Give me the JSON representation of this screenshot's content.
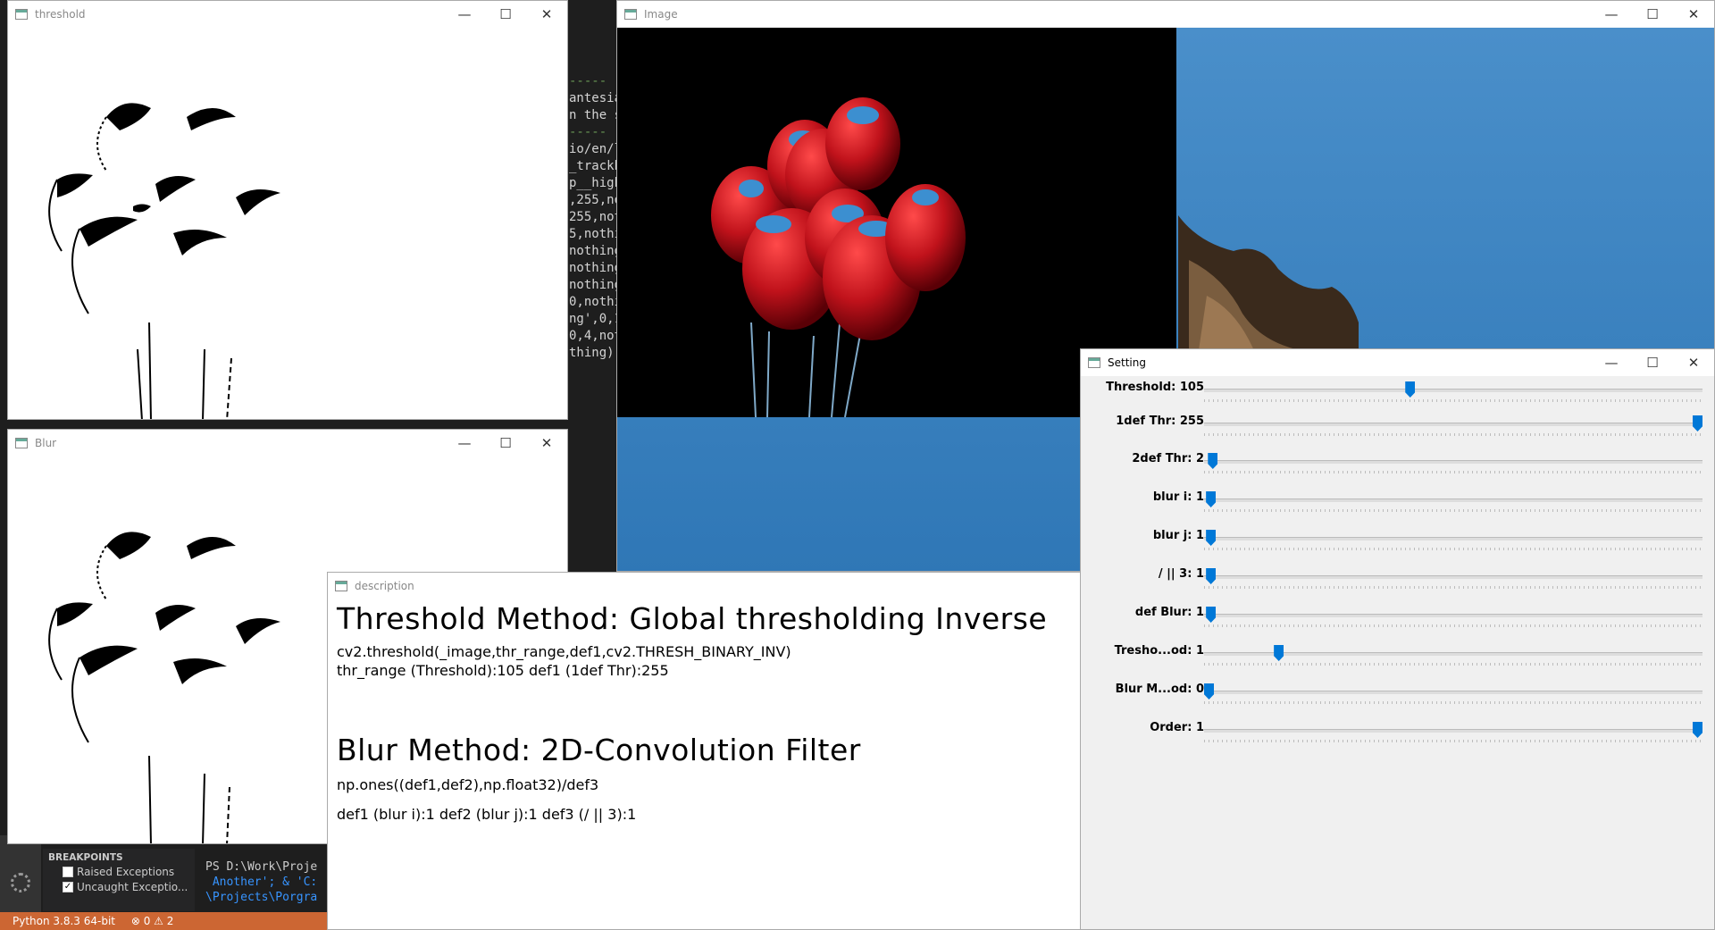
{
  "ide": {
    "code_lines": [
      "-----",
      "antesia",
      "n the s",
      "",
      "",
      "-----",
      "",
      "io/en/l",
      "_trackb",
      "",
      "p__high",
      "",
      "",
      ",255,no",
      "255,not",
      "5,nothi",
      "nothing",
      "nothing",
      "nothing",
      "0,nothi",
      "ng',0,1",
      "0,4,not",
      "thing)"
    ],
    "terminal": {
      "line1": "PS D:\\Work\\Proje",
      "line2": " Another'; & 'C:",
      "line3": "\\Projects\\Porgra"
    },
    "breakpoints": {
      "header": "BREAKPOINTS",
      "items": [
        {
          "label": "Raised Exceptions",
          "checked": false
        },
        {
          "label": "Uncaught Exceptio...",
          "checked": true
        }
      ]
    },
    "status": {
      "python": "Python 3.8.3 64-bit",
      "errors": "⊗ 0 ⚠ 2"
    }
  },
  "windows": {
    "threshold": {
      "title": "threshold"
    },
    "blur": {
      "title": "Blur"
    },
    "image": {
      "title": "Image"
    },
    "description": {
      "title": "description"
    },
    "setting": {
      "title": "Setting"
    }
  },
  "description": {
    "threshold_heading": "Threshold Method: Global thresholding Inverse",
    "threshold_code": "cv2.threshold(_image,thr_range,def1,cv2.THRESH_BINARY_INV)",
    "threshold_params": "thr_range (Threshold):105 def1 (1def Thr):255",
    "blur_heading": "Blur Method: 2D-Convolution Filter",
    "blur_code": "np.ones((def1,def2),np.float32)/def3",
    "blur_params": "def1 (blur i):1 def2 (blur j):1 def3 (/ || 3):1"
  },
  "setting": {
    "trackbars": [
      {
        "label": "Threshold: 105",
        "value": 105,
        "max": 255
      },
      {
        "label": "1def Thr: 255",
        "value": 255,
        "max": 255
      },
      {
        "label": "2def Thr: 2",
        "value": 2,
        "max": 255
      },
      {
        "label": "blur i: 1",
        "value": 1,
        "max": 255
      },
      {
        "label": "blur j: 1",
        "value": 1,
        "max": 255
      },
      {
        "label": "/ || 3: 1",
        "value": 1,
        "max": 255
      },
      {
        "label": "def Blur: 1",
        "value": 1,
        "max": 255
      },
      {
        "label": "Tresho...od: 1",
        "value": 1,
        "max": 7
      },
      {
        "label": "Blur M...od: 0",
        "value": 0,
        "max": 4
      },
      {
        "label": "Order: 1",
        "value": 1,
        "max": 1
      }
    ]
  },
  "colors": {
    "status_bar": "#cc6633",
    "thumb": "#0078d7",
    "sky": "#3f86c4",
    "balloon": "#c0121b"
  }
}
